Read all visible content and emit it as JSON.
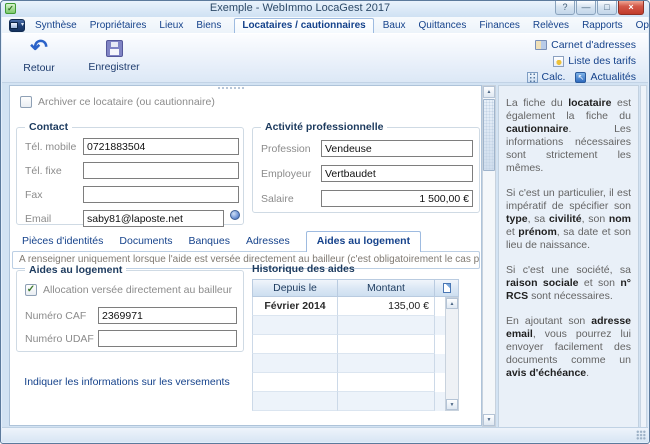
{
  "window": {
    "title": "Exemple - WebImmo LocaGest 2017",
    "controls": {
      "help": "?",
      "minimize": "—",
      "maximize": "□",
      "close": "×"
    }
  },
  "ribbon": {
    "tabs": [
      "Synthèse",
      "Propriétaires",
      "Lieux",
      "Biens",
      "Locataires / cautionnaires",
      "Baux",
      "Quittances",
      "Finances",
      "Relèves",
      "Rapports",
      "Options et contrôles"
    ],
    "active_tab": "Locataires / cautionnaires"
  },
  "toolbar": {
    "back_label": "Retour",
    "save_label": "Enregistrer",
    "links": [
      "Carnet d'adresses",
      "Liste des tarifs",
      "Calc.",
      "Actualités"
    ]
  },
  "form": {
    "archive_label": "Archiver ce locataire (ou cautionnaire)",
    "contact": {
      "title": "Contact",
      "fields": [
        {
          "label": "Tél. mobile",
          "value": "0721883504"
        },
        {
          "label": "Tél. fixe",
          "value": ""
        },
        {
          "label": "Fax",
          "value": ""
        },
        {
          "label": "Email",
          "value": "saby81@laposte.net"
        }
      ]
    },
    "activity": {
      "title": "Activité professionnelle",
      "fields": [
        {
          "label": "Profession",
          "value": "Vendeuse"
        },
        {
          "label": "Employeur",
          "value": "Vertbaudet"
        },
        {
          "label": "Salaire",
          "value": "1 500,00 €"
        }
      ]
    },
    "subtabs": [
      "Pièces d'identités",
      "Documents",
      "Banques",
      "Adresses",
      "Aides au logement"
    ],
    "active_subtab": "Aides au logement",
    "note": "A renseigner uniquement lorsque l'aide est versée directement au bailleur (c'est obligatoirement le cas pour l'APL).",
    "aides": {
      "title": "Aides au logement",
      "checkbox_label": "Allocation versée directement au bailleur",
      "checkbox_checked": true,
      "caf_label": "Numéro CAF",
      "caf_value": "2369971",
      "udaf_label": "Numéro UDAF",
      "udaf_value": ""
    },
    "payments_link": "Indiquer les informations sur les versements",
    "history": {
      "title": "Historique des aides",
      "columns": [
        "Depuis le",
        "Montant"
      ],
      "rows": [
        {
          "since": "Février 2014",
          "amount": "135,00 €"
        }
      ],
      "empty_row_count": 5
    }
  },
  "help": {
    "paragraphs": [
      {
        "segments": [
          {
            "t": "La fiche du ",
            "b": false
          },
          {
            "t": "locataire",
            "b": true
          },
          {
            "t": " est également la fiche du ",
            "b": false
          },
          {
            "t": "cautionnaire",
            "b": true
          },
          {
            "t": ". Les informations nécessaires sont strictement les mêmes.",
            "b": false
          }
        ]
      },
      {
        "segments": [
          {
            "t": "Si c'est un particulier, il est impératif de spécifier son ",
            "b": false
          },
          {
            "t": "type",
            "b": true
          },
          {
            "t": ", sa ",
            "b": false
          },
          {
            "t": "civilité",
            "b": true
          },
          {
            "t": ", son ",
            "b": false
          },
          {
            "t": "nom",
            "b": true
          },
          {
            "t": " et ",
            "b": false
          },
          {
            "t": "prénom",
            "b": true
          },
          {
            "t": ", sa date et son lieu de naissance.",
            "b": false
          }
        ]
      },
      {
        "segments": [
          {
            "t": "Si c'est une société, sa ",
            "b": false
          },
          {
            "t": "raison sociale",
            "b": true
          },
          {
            "t": " et son ",
            "b": false
          },
          {
            "t": "n° RCS",
            "b": true
          },
          {
            "t": " sont nécessaires.",
            "b": false
          }
        ]
      },
      {
        "segments": [
          {
            "t": "En ajoutant son ",
            "b": false
          },
          {
            "t": "adresse email",
            "b": true
          },
          {
            "t": ", vous pourrez lui envoyer facilement des documents comme un ",
            "b": false
          },
          {
            "t": "avis d'échéance",
            "b": true
          },
          {
            "t": ".",
            "b": false
          }
        ]
      }
    ]
  },
  "icons": {
    "check": "✓",
    "back_arrow": "↶",
    "dropdown_arrow": "▾",
    "up_arrow": "▲",
    "down_arrow": "▼",
    "news_arrow": "↖"
  },
  "colors": {
    "accent": "#15428b",
    "close_red": "#c13b2a",
    "check_green": "#3d7a2e",
    "panel_blue": "#d3e3f3"
  }
}
